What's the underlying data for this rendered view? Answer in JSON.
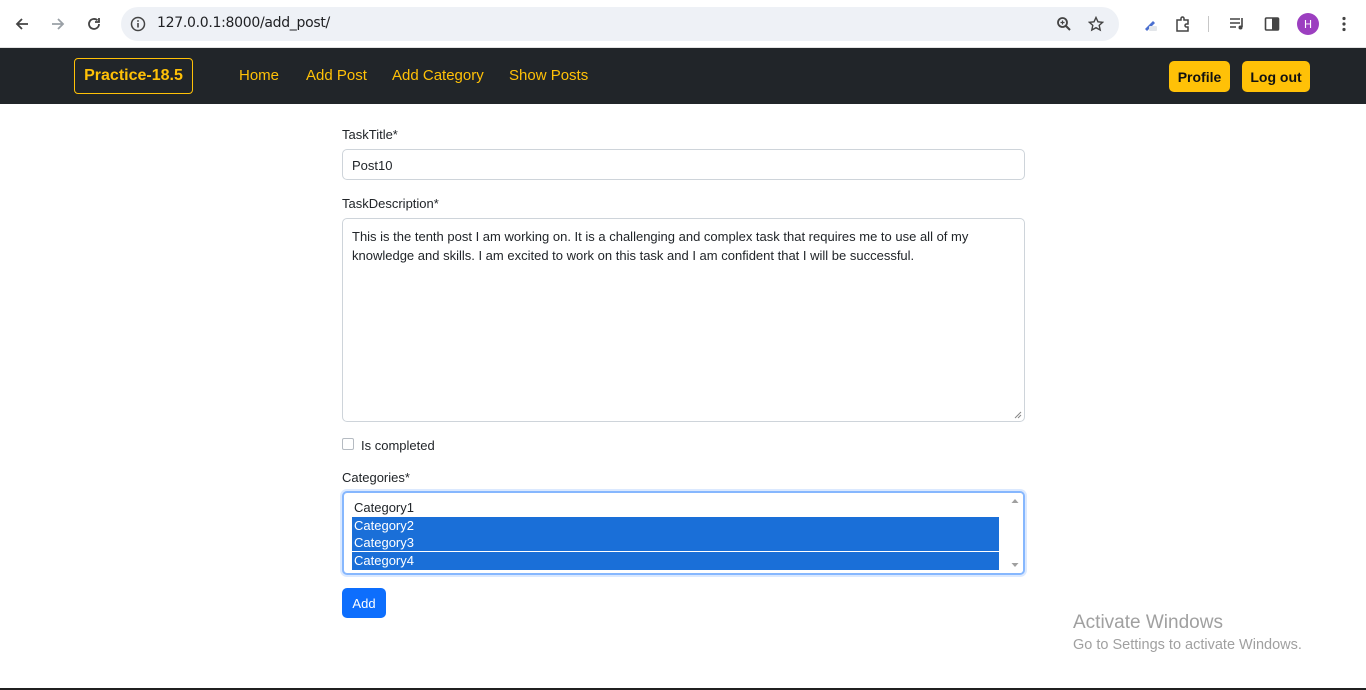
{
  "browser": {
    "url": "127.0.0.1:8000/add_post/",
    "profile_initial": "H"
  },
  "navbar": {
    "brand": "Practice-18.5",
    "links": [
      "Home",
      "Add Post",
      "Add Category",
      "Show Posts"
    ],
    "profile_label": "Profile",
    "logout_label": "Log out"
  },
  "form": {
    "title_label": "TaskTitle*",
    "title_value": "Post10",
    "description_label": "TaskDescription*",
    "description_value": "This is the tenth post I am working on. It is a challenging and complex task that requires me to use all of my knowledge and skills. I am excited to work on this task and I am confident that I will be successful.",
    "completed_label": "Is completed",
    "completed_checked": false,
    "categories_label": "Categories*",
    "categories": [
      {
        "name": "Category1",
        "selected": false
      },
      {
        "name": "Category2",
        "selected": true
      },
      {
        "name": "Category3",
        "selected": true
      },
      {
        "name": "Category4",
        "selected": true
      }
    ],
    "submit_label": "Add"
  },
  "watermark": {
    "line1": "Activate Windows",
    "line2": "Go to Settings to activate Windows."
  },
  "colors": {
    "navbar_bg": "#212529",
    "accent": "#ffc107",
    "primary": "#0d6efd",
    "selection": "#1a6fd8"
  }
}
